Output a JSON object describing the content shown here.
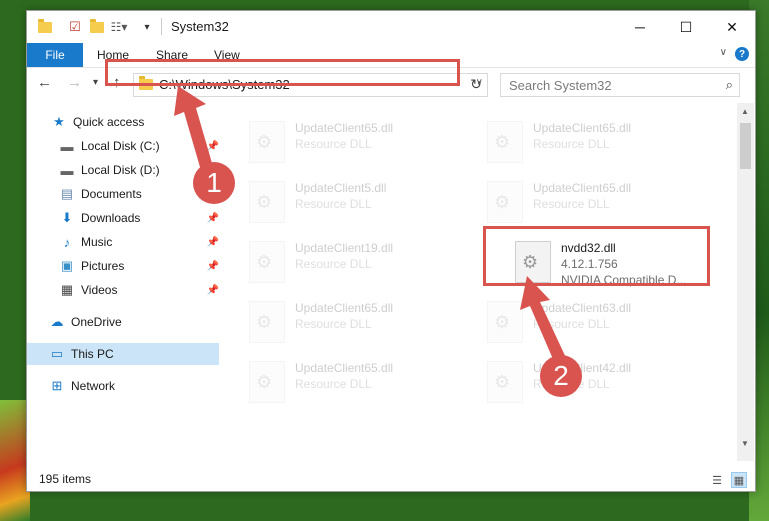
{
  "window": {
    "title": "System32"
  },
  "ribbon": {
    "file": "File",
    "tabs": [
      "Home",
      "Share",
      "View"
    ]
  },
  "address": {
    "path": "C:\\Windows\\System32"
  },
  "search": {
    "placeholder": "Search System32"
  },
  "sidebar": {
    "items": [
      {
        "label": "Quick access",
        "icon": "star-icon",
        "pinned": false
      },
      {
        "label": "Local Disk (C:)",
        "icon": "drive-icon",
        "pinned": true
      },
      {
        "label": "Local Disk (D:)",
        "icon": "drive-icon",
        "pinned": false
      },
      {
        "label": "Documents",
        "icon": "documents-icon",
        "pinned": false
      },
      {
        "label": "Downloads",
        "icon": "download-icon",
        "pinned": true
      },
      {
        "label": "Music",
        "icon": "music-icon",
        "pinned": true
      },
      {
        "label": "Pictures",
        "icon": "pictures-icon",
        "pinned": true
      },
      {
        "label": "Videos",
        "icon": "videos-icon",
        "pinned": true
      },
      {
        "label": "OneDrive",
        "icon": "cloud-icon",
        "pinned": false
      },
      {
        "label": "This PC",
        "icon": "pc-icon",
        "pinned": false
      },
      {
        "label": "Network",
        "icon": "network-icon",
        "pinned": false
      }
    ]
  },
  "files": [
    {
      "name": "UpdateClient65.dll",
      "type": "Resource DLL"
    },
    {
      "name": "UpdateClient65.dll",
      "type": "Resource DLL"
    },
    {
      "name": "UpdateClient5.dll",
      "type": "Resource DLL"
    },
    {
      "name": "UpdateClient65.dll",
      "type": "Resource DLL"
    },
    {
      "name": "UpdateClient19.dll",
      "type": "Resource DLL"
    },
    {
      "name": "nvdd32.dll",
      "version": "4.12.1.756",
      "description": "NVIDIA Compatible D..."
    },
    {
      "name": "UpdateClient65.dll",
      "type": "Resource DLL"
    },
    {
      "name": "UpdateClient63.dll",
      "type": "Resource DLL"
    },
    {
      "name": "UpdateClient65.dll",
      "type": "Resource DLL"
    },
    {
      "name": "UpdateClient42.dll",
      "type": "Resource DLL"
    }
  ],
  "status": {
    "count": "195 items"
  },
  "annotations": {
    "step1": "1",
    "step2": "2"
  },
  "colors": {
    "accent": "#1979ca",
    "highlight": "#d9534f",
    "selected": "#cce4f7"
  }
}
